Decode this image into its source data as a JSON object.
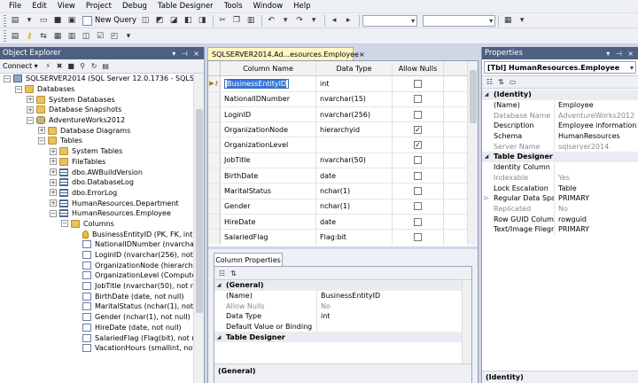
{
  "menu": [
    "File",
    "Edit",
    "View",
    "Project",
    "Debug",
    "Table Designer",
    "Tools",
    "Window",
    "Help"
  ],
  "toolbar": {
    "new_query_label": "New Query"
  },
  "object_explorer": {
    "title": "Object Explorer",
    "connect_label": "Connect ▾",
    "tree": [
      {
        "depth": 0,
        "toggle": "−",
        "icon": "server",
        "label": "SQLSERVER2014 (SQL Server 12.0.1736 - SQLSERVER"
      },
      {
        "depth": 1,
        "toggle": "−",
        "icon": "folder",
        "label": "Databases"
      },
      {
        "depth": 2,
        "toggle": "+",
        "icon": "folder",
        "label": "System Databases"
      },
      {
        "depth": 2,
        "toggle": "+",
        "icon": "folder",
        "label": "Database Snapshots"
      },
      {
        "depth": 2,
        "toggle": "−",
        "icon": "db",
        "label": "AdventureWorks2012"
      },
      {
        "depth": 3,
        "toggle": "+",
        "icon": "folder",
        "label": "Database Diagrams"
      },
      {
        "depth": 3,
        "toggle": "−",
        "icon": "folder",
        "label": "Tables"
      },
      {
        "depth": 4,
        "toggle": "+",
        "icon": "folder",
        "label": "System Tables"
      },
      {
        "depth": 4,
        "toggle": "+",
        "icon": "folder",
        "label": "FileTables"
      },
      {
        "depth": 4,
        "toggle": "+",
        "icon": "table",
        "label": "dbo.AWBuildVersion"
      },
      {
        "depth": 4,
        "toggle": "+",
        "icon": "table",
        "label": "dbo.DatabaseLog"
      },
      {
        "depth": 4,
        "toggle": "+",
        "icon": "table",
        "label": "dbo.ErrorLog"
      },
      {
        "depth": 4,
        "toggle": "+",
        "icon": "table",
        "label": "HumanResources.Department"
      },
      {
        "depth": 4,
        "toggle": "−",
        "icon": "table",
        "label": "HumanResources.Employee"
      },
      {
        "depth": 5,
        "toggle": "−",
        "icon": "folder",
        "label": "Columns"
      },
      {
        "depth": 6,
        "toggle": "",
        "icon": "key",
        "label": "BusinessEntityID (PK, FK, int, n"
      },
      {
        "depth": 6,
        "toggle": "",
        "icon": "col",
        "label": "NationalIDNumber (nvarchar"
      },
      {
        "depth": 6,
        "toggle": "",
        "icon": "col",
        "label": "LoginID (nvarchar(256), not n"
      },
      {
        "depth": 6,
        "toggle": "",
        "icon": "col",
        "label": "OrganizationNode (hierarchyi"
      },
      {
        "depth": 6,
        "toggle": "",
        "icon": "col",
        "label": "OrganizationLevel (Computed"
      },
      {
        "depth": 6,
        "toggle": "",
        "icon": "col",
        "label": "JobTitle (nvarchar(50), not nu"
      },
      {
        "depth": 6,
        "toggle": "",
        "icon": "col",
        "label": "BirthDate (date, not null)"
      },
      {
        "depth": 6,
        "toggle": "",
        "icon": "col",
        "label": "MaritalStatus (nchar(1), not n"
      },
      {
        "depth": 6,
        "toggle": "",
        "icon": "col",
        "label": "Gender (nchar(1), not null)"
      },
      {
        "depth": 6,
        "toggle": "",
        "icon": "col",
        "label": "HireDate (date, not null)"
      },
      {
        "depth": 6,
        "toggle": "",
        "icon": "col",
        "label": "SalariedFlag (Flag(bit), not nu"
      },
      {
        "depth": 6,
        "toggle": "",
        "icon": "col",
        "label": "VacationHours (smallint, not"
      }
    ]
  },
  "document": {
    "tab_label": "SQLSERVER2014.Ad...esources.Employee",
    "tab_close": "×",
    "headers": {
      "column_name": "Column Name",
      "data_type": "Data Type",
      "allow_nulls": "Allow Nulls"
    },
    "rows": [
      {
        "name": "BusinessEntityID",
        "type": "int",
        "nulls": false,
        "pk": true
      },
      {
        "name": "NationalIDNumber",
        "type": "nvarchar(15)",
        "nulls": false
      },
      {
        "name": "LoginID",
        "type": "nvarchar(256)",
        "nulls": false
      },
      {
        "name": "OrganizationNode",
        "type": "hierarchyid",
        "nulls": true
      },
      {
        "name": "OrganizationLevel",
        "type": "",
        "nulls": true
      },
      {
        "name": "JobTitle",
        "type": "nvarchar(50)",
        "nulls": false
      },
      {
        "name": "BirthDate",
        "type": "date",
        "nulls": false
      },
      {
        "name": "MaritalStatus",
        "type": "nchar(1)",
        "nulls": false
      },
      {
        "name": "Gender",
        "type": "nchar(1)",
        "nulls": false
      },
      {
        "name": "HireDate",
        "type": "date",
        "nulls": false
      },
      {
        "name": "SalariedFlag",
        "type": "Flag:bit",
        "nulls": false
      },
      {
        "name": "VacationHours",
        "type": "smallint",
        "nulls": false
      }
    ]
  },
  "column_properties": {
    "tab_label": "Column Properties",
    "rows": [
      {
        "kind": "cat",
        "marker": "◢",
        "name": "(General)",
        "value": ""
      },
      {
        "kind": "",
        "marker": "",
        "name": "(Name)",
        "value": "BusinessEntityID"
      },
      {
        "kind": "dis",
        "marker": "",
        "name": "Allow Nulls",
        "value": "No"
      },
      {
        "kind": "",
        "marker": "",
        "name": "Data Type",
        "value": "int"
      },
      {
        "kind": "",
        "marker": "",
        "name": "Default Value or Binding",
        "value": ""
      },
      {
        "kind": "cat",
        "marker": "◢",
        "name": "Table Designer",
        "value": ""
      }
    ],
    "description_title": "(General)"
  },
  "properties": {
    "title": "Properties",
    "selector": "[Tbl] HumanResources.Employee",
    "rows": [
      {
        "kind": "cat",
        "marker": "◢",
        "name": "(Identity)",
        "value": ""
      },
      {
        "kind": "",
        "marker": "",
        "name": "(Name)",
        "value": "Employee"
      },
      {
        "kind": "dis",
        "marker": "",
        "name": "Database Name",
        "value": "AdventureWorks2012"
      },
      {
        "kind": "",
        "marker": "",
        "name": "Description",
        "value": "Employee information s"
      },
      {
        "kind": "",
        "marker": "",
        "name": "Schema",
        "value": "HumanResources"
      },
      {
        "kind": "dis",
        "marker": "",
        "name": "Server Name",
        "value": "sqlserver2014"
      },
      {
        "kind": "cat",
        "marker": "◢",
        "name": "Table Designer",
        "value": ""
      },
      {
        "kind": "",
        "marker": "",
        "name": "Identity Column",
        "value": ""
      },
      {
        "kind": "dis",
        "marker": "",
        "name": "Indexable",
        "value": "Yes"
      },
      {
        "kind": "",
        "marker": "",
        "name": "Lock Escalation",
        "value": "Table"
      },
      {
        "kind": "",
        "marker": "▷",
        "name": "Regular Data Spac",
        "value": "PRIMARY"
      },
      {
        "kind": "dis",
        "marker": "",
        "name": "Replicated",
        "value": "No"
      },
      {
        "kind": "",
        "marker": "",
        "name": "Row GUID Columr",
        "value": "rowguid"
      },
      {
        "kind": "",
        "marker": "",
        "name": "Text/Image Filegr",
        "value": "PRIMARY"
      }
    ],
    "description_title": "(Identity)"
  }
}
